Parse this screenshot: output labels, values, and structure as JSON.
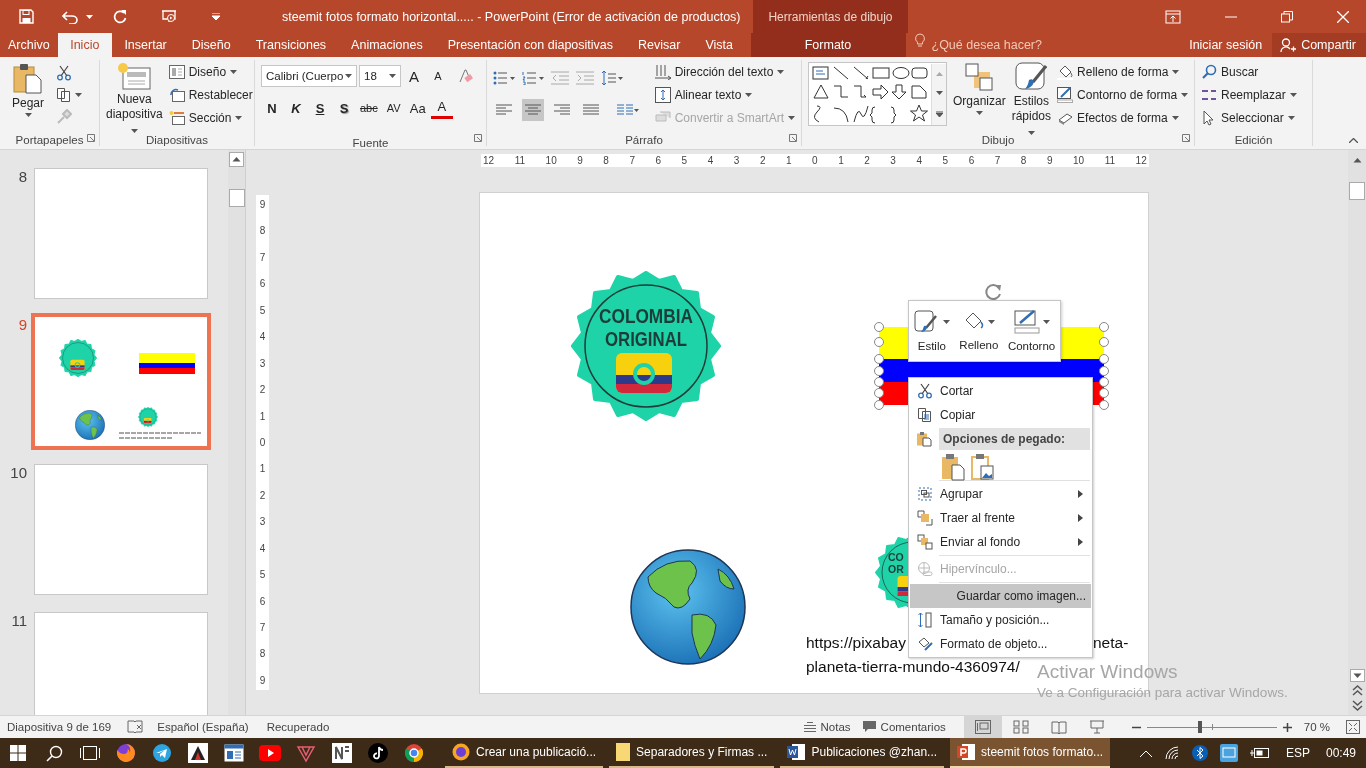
{
  "title_bar": {
    "title": "steemit fotos formato horizontal..... - PowerPoint (Error de activación de productos)",
    "context_group": "Herramientas de dibujo"
  },
  "ribbon_tabs": [
    {
      "label": "Archivo",
      "selected": false,
      "kind": "plain"
    },
    {
      "label": "Inicio",
      "selected": true,
      "kind": "plain"
    },
    {
      "label": "Insertar",
      "selected": false,
      "kind": "plain"
    },
    {
      "label": "Diseño",
      "selected": false,
      "kind": "plain"
    },
    {
      "label": "Transiciones",
      "selected": false,
      "kind": "plain"
    },
    {
      "label": "Animaciones",
      "selected": false,
      "kind": "plain"
    },
    {
      "label": "Presentación con diapositivas",
      "selected": false,
      "kind": "plain"
    },
    {
      "label": "Revisar",
      "selected": false,
      "kind": "plain"
    },
    {
      "label": "Vista",
      "selected": false,
      "kind": "plain"
    },
    {
      "label": "Formato",
      "selected": false,
      "kind": "contextual"
    }
  ],
  "tell_me": {
    "placeholder": "¿Qué desea hacer?"
  },
  "account": {
    "sign_in": "Iniciar sesión",
    "share": "Compartir"
  },
  "ribbon": {
    "clipboard": {
      "label": "Portapapeles",
      "paste": "Pegar"
    },
    "slides": {
      "label": "Diapositivas",
      "new_slide": "Nueva diapositiva",
      "layout": "Diseño",
      "reset": "Restablecer",
      "section": "Sección"
    },
    "font": {
      "label": "Fuente",
      "font_name": "Calibri (Cuerpo",
      "font_size": "18",
      "size_buttons": [
        "A",
        "A"
      ],
      "format_buttons": [
        {
          "text": "N",
          "kind": "bold"
        },
        {
          "text": "K",
          "kind": "italic"
        },
        {
          "text": "S",
          "kind": "underline"
        },
        {
          "text": "S",
          "kind": "shadow"
        },
        {
          "text": "abc",
          "kind": "strike"
        },
        {
          "text": "AV",
          "kind": "spacing"
        },
        {
          "text": "Aa",
          "kind": "case"
        },
        {
          "text": "A",
          "kind": "color"
        }
      ]
    },
    "paragraph": {
      "label": "Párrafo",
      "text_direction": "Dirección del texto",
      "align_text": "Alinear texto",
      "smartart": {
        "label": "Convertir a SmartArt",
        "disabled": true
      },
      "alignments": [
        {
          "kind": "left",
          "selected": false
        },
        {
          "kind": "center",
          "selected": true
        },
        {
          "kind": "right",
          "selected": false
        },
        {
          "kind": "justify",
          "selected": false
        }
      ]
    },
    "drawing": {
      "label": "Dibujo",
      "arrange": "Organizar",
      "quick_styles": "Estilos rápidos",
      "shape_fill": "Relleno de forma",
      "shape_outline": "Contorno de forma",
      "shape_effects": "Efectos de forma"
    },
    "editing": {
      "label": "Edición",
      "find": "Buscar",
      "replace": "Reemplazar",
      "select": "Seleccionar"
    }
  },
  "slide_thumbnails": [
    {
      "number": "8",
      "selected": false,
      "kind": "blank"
    },
    {
      "number": "9",
      "selected": true,
      "kind": "content"
    },
    {
      "number": "10",
      "selected": false,
      "kind": "blank"
    },
    {
      "number": "11",
      "selected": false,
      "kind": "blank"
    }
  ],
  "rulers": {
    "horizontal": [
      "12",
      "11",
      "10",
      "9",
      "8",
      "7",
      "6",
      "5",
      "4",
      "3",
      "2",
      "1",
      "0",
      "1",
      "2",
      "3",
      "4",
      "5",
      "6",
      "7",
      "8",
      "9",
      "10",
      "11",
      "12"
    ],
    "vertical": [
      "9",
      "8",
      "7",
      "6",
      "5",
      "4",
      "3",
      "2",
      "1",
      "0",
      "1",
      "2",
      "3",
      "4",
      "5",
      "6",
      "7",
      "8",
      "9"
    ]
  },
  "slide": {
    "badges": [
      {
        "lines": [
          "COLOMBIA",
          "ORIGINAL"
        ]
      },
      {
        "lines": [
          "CO",
          "OR"
        ]
      }
    ],
    "url_parts": [
      "https://pixabay",
      "neta-",
      "planeta-tierra-mundo-4360974/"
    ]
  },
  "mini_toolbar": [
    {
      "label": "Estilo",
      "kind": "style"
    },
    {
      "label": "Relleno",
      "kind": "fill"
    },
    {
      "label": "Contorno",
      "kind": "outline"
    }
  ],
  "context_menu": [
    {
      "kind": "item",
      "label": "Cortar",
      "disabled": false,
      "selected": false,
      "submenu": false
    },
    {
      "kind": "item",
      "label": "Copiar",
      "disabled": false,
      "selected": false,
      "submenu": false
    },
    {
      "kind": "header",
      "label": "Opciones de pegado:"
    },
    {
      "kind": "paste_options"
    },
    {
      "kind": "separator"
    },
    {
      "kind": "item",
      "label": "Agrupar",
      "disabled": false,
      "selected": false,
      "submenu": true
    },
    {
      "kind": "item",
      "label": "Traer al frente",
      "disabled": false,
      "selected": false,
      "submenu": true
    },
    {
      "kind": "item",
      "label": "Enviar al fondo",
      "disabled": false,
      "selected": false,
      "submenu": true
    },
    {
      "kind": "separator"
    },
    {
      "kind": "item",
      "label": "Hipervínculo...",
      "disabled": true,
      "selected": false,
      "submenu": false
    },
    {
      "kind": "separator"
    },
    {
      "kind": "item",
      "label": "Guardar como imagen...",
      "disabled": false,
      "selected": true,
      "submenu": false
    },
    {
      "kind": "item",
      "label": "Tamaño y posición...",
      "disabled": false,
      "selected": false,
      "submenu": false
    },
    {
      "kind": "item",
      "label": "Formato de objeto...",
      "disabled": false,
      "selected": false,
      "submenu": false
    }
  ],
  "activation_notice": {
    "title": "Activar Windows",
    "text": "Ve a Configuración para activar Windows."
  },
  "status_bar": {
    "slide_info": "Diapositiva 9 de 169",
    "language": "Español (España)",
    "save_state": "Recuperado",
    "notes": "Notas",
    "comments": "Comentarios",
    "views": [
      {
        "kind": "normal",
        "selected": true
      },
      {
        "kind": "sorter",
        "selected": false
      },
      {
        "kind": "reading",
        "selected": false
      },
      {
        "kind": "slideshow",
        "selected": false
      }
    ],
    "zoom": {
      "level": 0.41,
      "reading": "70 %"
    }
  },
  "taskbar": {
    "windows": [
      {
        "label": "Crear una publicació...",
        "selected": false
      },
      {
        "label": "Separadores y Firmas ...",
        "selected": false
      },
      {
        "label": "Publicaciones @zhan...",
        "selected": false
      },
      {
        "label": "steemit fotos formato...",
        "selected": true
      }
    ],
    "language": "ESP",
    "time": "00:49"
  }
}
